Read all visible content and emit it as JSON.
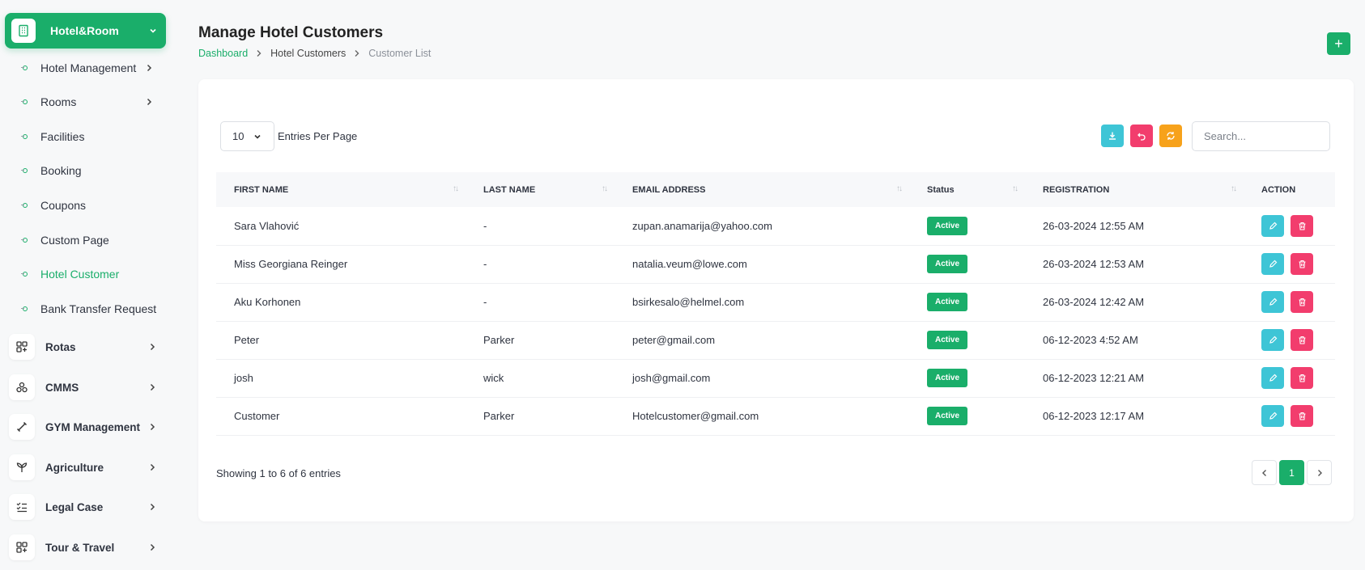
{
  "sidebar": {
    "active_group": {
      "label": "Hotel&Room",
      "icon": "building-icon"
    },
    "sub_items": [
      {
        "label": "Hotel Management",
        "has_children": true
      },
      {
        "label": "Rooms",
        "has_children": true
      },
      {
        "label": "Facilities",
        "has_children": false
      },
      {
        "label": "Booking",
        "has_children": false
      },
      {
        "label": "Coupons",
        "has_children": false
      },
      {
        "label": "Custom Page",
        "has_children": false
      },
      {
        "label": "Hotel Customer",
        "has_children": false,
        "current": true
      },
      {
        "label": "Bank Transfer Request",
        "has_children": false
      }
    ],
    "groups": [
      {
        "label": "Rotas",
        "icon": "grid-icon"
      },
      {
        "label": "CMMS",
        "icon": "circles-icon"
      },
      {
        "label": "GYM Management",
        "icon": "dumbbell-icon"
      },
      {
        "label": "Agriculture",
        "icon": "plant-icon"
      },
      {
        "label": "Legal Case",
        "icon": "checklist-icon"
      },
      {
        "label": "Tour & Travel",
        "icon": "apps-plus-icon"
      }
    ]
  },
  "header": {
    "title": "Manage Hotel Customers",
    "breadcrumb": [
      "Dashboard",
      "Hotel Customers",
      "Customer List"
    ],
    "add_label": "+"
  },
  "controls": {
    "per_page_value": "10",
    "per_page_label": "Entries Per Page",
    "search_placeholder": "Search..."
  },
  "table": {
    "columns": [
      "FIRST NAME",
      "LAST NAME",
      "EMAIL ADDRESS",
      "Status",
      "REGISTRATION",
      "ACTION"
    ],
    "rows": [
      {
        "first": "Sara Vlahović",
        "last": "-",
        "email": "zupan.anamarija@yahoo.com",
        "status": "Active",
        "registration": "26-03-2024 12:55 AM"
      },
      {
        "first": "Miss Georgiana Reinger",
        "last": "-",
        "email": "natalia.veum@lowe.com",
        "status": "Active",
        "registration": "26-03-2024 12:53 AM"
      },
      {
        "first": "Aku Korhonen",
        "last": "-",
        "email": "bsirkesalo@helmel.com",
        "status": "Active",
        "registration": "26-03-2024 12:42 AM"
      },
      {
        "first": "Peter",
        "last": "Parker",
        "email": "peter@gmail.com",
        "status": "Active",
        "registration": "06-12-2023 4:52 AM"
      },
      {
        "first": "josh",
        "last": "wick",
        "email": "josh@gmail.com",
        "status": "Active",
        "registration": "06-12-2023 12:21 AM"
      },
      {
        "first": "Customer",
        "last": "Parker",
        "email": "Hotelcustomer@gmail.com",
        "status": "Active",
        "registration": "06-12-2023 12:17 AM"
      }
    ]
  },
  "footer": {
    "showing": "Showing 1 to 6 of 6 entries",
    "current_page": "1"
  },
  "colors": {
    "accent": "#1aae6a",
    "edit": "#3ec5d6",
    "delete": "#f23d6d",
    "export": "#3ec5d6",
    "undo": "#f23d6d",
    "refresh": "#f7a21b"
  }
}
